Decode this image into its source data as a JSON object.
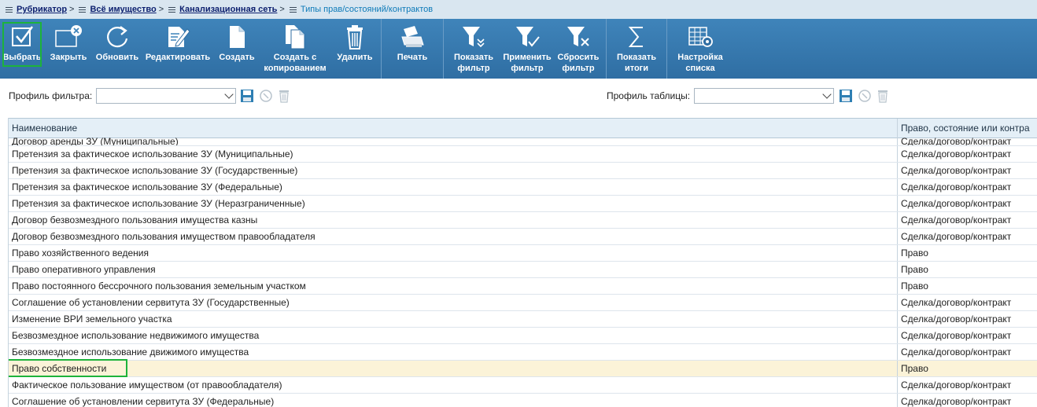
{
  "breadcrumb": {
    "items": [
      "Рубрикатор",
      "Всё имущество",
      "Канализационная сеть"
    ],
    "separator": ">",
    "current": "Типы прав/состояний/контрактов"
  },
  "toolbar": {
    "select": "Выбрать",
    "close": "Закрыть",
    "refresh": "Обновить",
    "edit": "Редактировать",
    "create": "Создать",
    "create_copy": "Создать с\nкопированием",
    "delete": "Удалить",
    "print": "Печать",
    "show_filter": "Показать\nфильтр",
    "apply_filter": "Применить\nфильтр",
    "reset_filter": "Сбросить\nфильтр",
    "show_totals": "Показать\nитоги",
    "list_settings": "Настройка\nсписка"
  },
  "filter": {
    "filter_profile_label": "Профиль фильтра:",
    "table_profile_label": "Профиль таблицы:",
    "filter_profile_value": "",
    "table_profile_value": ""
  },
  "table": {
    "headers": [
      "Наименование",
      "Право, состояние или контра"
    ],
    "partial_row": [
      "Договор аренды ЗУ (Муниципальные)",
      "Сделка/договор/контракт"
    ],
    "rows": [
      [
        "Претензия за фактическое использование ЗУ (Муниципальные)",
        "Сделка/договор/контракт"
      ],
      [
        "Претензия за фактическое использование ЗУ (Государственные)",
        "Сделка/договор/контракт"
      ],
      [
        "Претензия за фактическое использование ЗУ (Федеральные)",
        "Сделка/договор/контракт"
      ],
      [
        "Претензия за фактическое использование ЗУ (Неразграниченные)",
        "Сделка/договор/контракт"
      ],
      [
        "Договор безвозмездного пользования имущества казны",
        "Сделка/договор/контракт"
      ],
      [
        "Договор безвозмездного пользования имуществом правообладателя",
        "Сделка/договор/контракт"
      ],
      [
        "Право хозяйственного ведения",
        "Право"
      ],
      [
        "Право оперативного управления",
        "Право"
      ],
      [
        "Право постоянного бессрочного пользования земельным участком",
        "Право"
      ],
      [
        "Соглашение об установлении сервитута ЗУ (Государственные)",
        "Сделка/договор/контракт"
      ],
      [
        "Изменение ВРИ земельного участка",
        "Сделка/договор/контракт"
      ],
      [
        "Безвозмездное использование недвижимого имущества",
        "Сделка/договор/контракт"
      ],
      [
        "Безвозмездное использование движимого имущества",
        "Сделка/договор/контракт"
      ],
      [
        "Право собственности",
        "Право"
      ],
      [
        "Фактическое пользование имуществом (от правообладателя)",
        "Сделка/договор/контракт"
      ],
      [
        "Соглашение об установлении сервитута ЗУ (Федеральные)",
        "Сделка/договор/контракт"
      ]
    ],
    "selected_row_index": 13
  }
}
